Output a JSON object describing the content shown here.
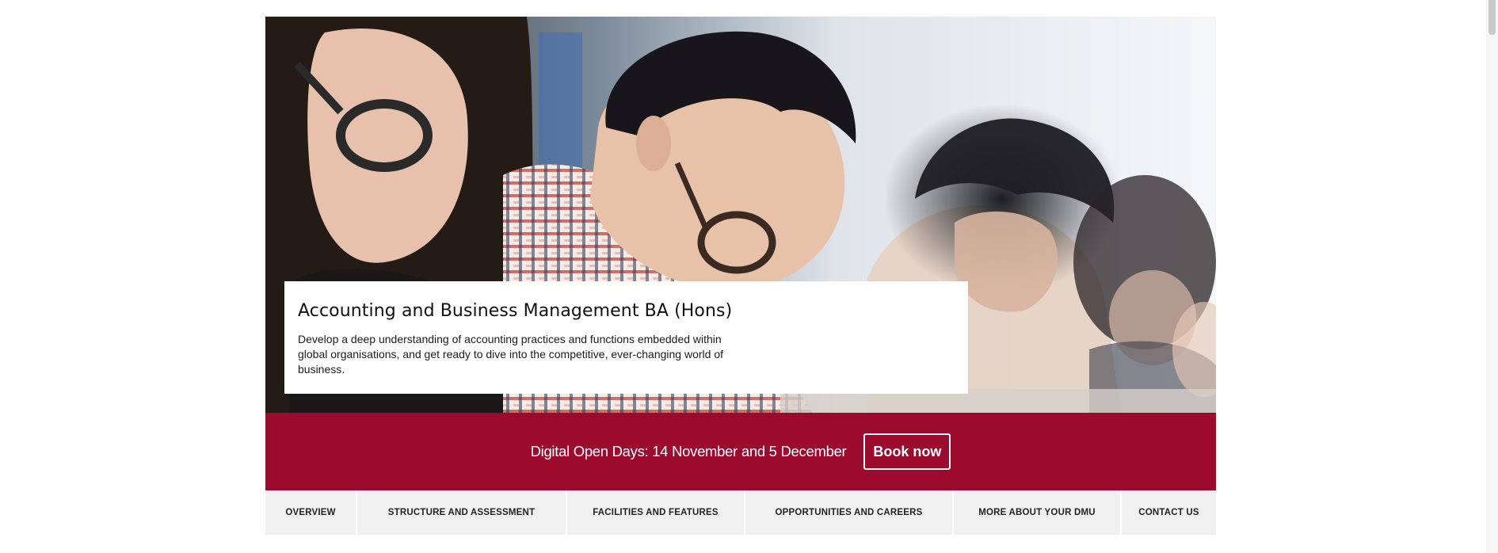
{
  "hero": {
    "image_icon": "photo-students-studying",
    "title": "Accounting and Business Management BA (Hons)",
    "description": "Develop a deep understanding of accounting practices and functions embedded within global organisations, and get ready to dive into the competitive, ever-changing world of business."
  },
  "promo": {
    "text": "Digital Open Days: 14 November and 5 December",
    "button_label": "Book now",
    "background_color": "#9c0a2d"
  },
  "tabs": [
    {
      "label": "OVERVIEW"
    },
    {
      "label": "STRUCTURE AND ASSESSMENT"
    },
    {
      "label": "FACILITIES AND FEATURES"
    },
    {
      "label": "OPPORTUNITIES AND CAREERS"
    },
    {
      "label": "MORE ABOUT YOUR DMU"
    },
    {
      "label": "CONTACT US"
    }
  ]
}
